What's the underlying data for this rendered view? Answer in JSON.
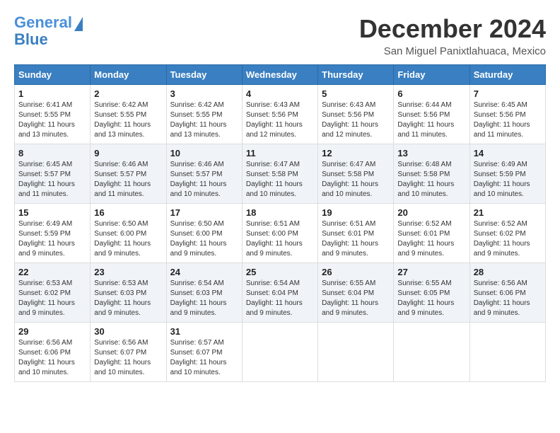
{
  "logo": {
    "line1": "General",
    "line2": "Blue"
  },
  "title": "December 2024",
  "location": "San Miguel Panixtlahuaca, Mexico",
  "days_header": [
    "Sunday",
    "Monday",
    "Tuesday",
    "Wednesday",
    "Thursday",
    "Friday",
    "Saturday"
  ],
  "weeks": [
    [
      {
        "day": "1",
        "sunrise": "Sunrise: 6:41 AM",
        "sunset": "Sunset: 5:55 PM",
        "daylight": "Daylight: 11 hours and 13 minutes."
      },
      {
        "day": "2",
        "sunrise": "Sunrise: 6:42 AM",
        "sunset": "Sunset: 5:55 PM",
        "daylight": "Daylight: 11 hours and 13 minutes."
      },
      {
        "day": "3",
        "sunrise": "Sunrise: 6:42 AM",
        "sunset": "Sunset: 5:55 PM",
        "daylight": "Daylight: 11 hours and 13 minutes."
      },
      {
        "day": "4",
        "sunrise": "Sunrise: 6:43 AM",
        "sunset": "Sunset: 5:56 PM",
        "daylight": "Daylight: 11 hours and 12 minutes."
      },
      {
        "day": "5",
        "sunrise": "Sunrise: 6:43 AM",
        "sunset": "Sunset: 5:56 PM",
        "daylight": "Daylight: 11 hours and 12 minutes."
      },
      {
        "day": "6",
        "sunrise": "Sunrise: 6:44 AM",
        "sunset": "Sunset: 5:56 PM",
        "daylight": "Daylight: 11 hours and 11 minutes."
      },
      {
        "day": "7",
        "sunrise": "Sunrise: 6:45 AM",
        "sunset": "Sunset: 5:56 PM",
        "daylight": "Daylight: 11 hours and 11 minutes."
      }
    ],
    [
      {
        "day": "8",
        "sunrise": "Sunrise: 6:45 AM",
        "sunset": "Sunset: 5:57 PM",
        "daylight": "Daylight: 11 hours and 11 minutes."
      },
      {
        "day": "9",
        "sunrise": "Sunrise: 6:46 AM",
        "sunset": "Sunset: 5:57 PM",
        "daylight": "Daylight: 11 hours and 11 minutes."
      },
      {
        "day": "10",
        "sunrise": "Sunrise: 6:46 AM",
        "sunset": "Sunset: 5:57 PM",
        "daylight": "Daylight: 11 hours and 10 minutes."
      },
      {
        "day": "11",
        "sunrise": "Sunrise: 6:47 AM",
        "sunset": "Sunset: 5:58 PM",
        "daylight": "Daylight: 11 hours and 10 minutes."
      },
      {
        "day": "12",
        "sunrise": "Sunrise: 6:47 AM",
        "sunset": "Sunset: 5:58 PM",
        "daylight": "Daylight: 11 hours and 10 minutes."
      },
      {
        "day": "13",
        "sunrise": "Sunrise: 6:48 AM",
        "sunset": "Sunset: 5:58 PM",
        "daylight": "Daylight: 11 hours and 10 minutes."
      },
      {
        "day": "14",
        "sunrise": "Sunrise: 6:49 AM",
        "sunset": "Sunset: 5:59 PM",
        "daylight": "Daylight: 11 hours and 10 minutes."
      }
    ],
    [
      {
        "day": "15",
        "sunrise": "Sunrise: 6:49 AM",
        "sunset": "Sunset: 5:59 PM",
        "daylight": "Daylight: 11 hours and 9 minutes."
      },
      {
        "day": "16",
        "sunrise": "Sunrise: 6:50 AM",
        "sunset": "Sunset: 6:00 PM",
        "daylight": "Daylight: 11 hours and 9 minutes."
      },
      {
        "day": "17",
        "sunrise": "Sunrise: 6:50 AM",
        "sunset": "Sunset: 6:00 PM",
        "daylight": "Daylight: 11 hours and 9 minutes."
      },
      {
        "day": "18",
        "sunrise": "Sunrise: 6:51 AM",
        "sunset": "Sunset: 6:00 PM",
        "daylight": "Daylight: 11 hours and 9 minutes."
      },
      {
        "day": "19",
        "sunrise": "Sunrise: 6:51 AM",
        "sunset": "Sunset: 6:01 PM",
        "daylight": "Daylight: 11 hours and 9 minutes."
      },
      {
        "day": "20",
        "sunrise": "Sunrise: 6:52 AM",
        "sunset": "Sunset: 6:01 PM",
        "daylight": "Daylight: 11 hours and 9 minutes."
      },
      {
        "day": "21",
        "sunrise": "Sunrise: 6:52 AM",
        "sunset": "Sunset: 6:02 PM",
        "daylight": "Daylight: 11 hours and 9 minutes."
      }
    ],
    [
      {
        "day": "22",
        "sunrise": "Sunrise: 6:53 AM",
        "sunset": "Sunset: 6:02 PM",
        "daylight": "Daylight: 11 hours and 9 minutes."
      },
      {
        "day": "23",
        "sunrise": "Sunrise: 6:53 AM",
        "sunset": "Sunset: 6:03 PM",
        "daylight": "Daylight: 11 hours and 9 minutes."
      },
      {
        "day": "24",
        "sunrise": "Sunrise: 6:54 AM",
        "sunset": "Sunset: 6:03 PM",
        "daylight": "Daylight: 11 hours and 9 minutes."
      },
      {
        "day": "25",
        "sunrise": "Sunrise: 6:54 AM",
        "sunset": "Sunset: 6:04 PM",
        "daylight": "Daylight: 11 hours and 9 minutes."
      },
      {
        "day": "26",
        "sunrise": "Sunrise: 6:55 AM",
        "sunset": "Sunset: 6:04 PM",
        "daylight": "Daylight: 11 hours and 9 minutes."
      },
      {
        "day": "27",
        "sunrise": "Sunrise: 6:55 AM",
        "sunset": "Sunset: 6:05 PM",
        "daylight": "Daylight: 11 hours and 9 minutes."
      },
      {
        "day": "28",
        "sunrise": "Sunrise: 6:56 AM",
        "sunset": "Sunset: 6:06 PM",
        "daylight": "Daylight: 11 hours and 9 minutes."
      }
    ],
    [
      {
        "day": "29",
        "sunrise": "Sunrise: 6:56 AM",
        "sunset": "Sunset: 6:06 PM",
        "daylight": "Daylight: 11 hours and 10 minutes."
      },
      {
        "day": "30",
        "sunrise": "Sunrise: 6:56 AM",
        "sunset": "Sunset: 6:07 PM",
        "daylight": "Daylight: 11 hours and 10 minutes."
      },
      {
        "day": "31",
        "sunrise": "Sunrise: 6:57 AM",
        "sunset": "Sunset: 6:07 PM",
        "daylight": "Daylight: 11 hours and 10 minutes."
      },
      null,
      null,
      null,
      null
    ]
  ]
}
